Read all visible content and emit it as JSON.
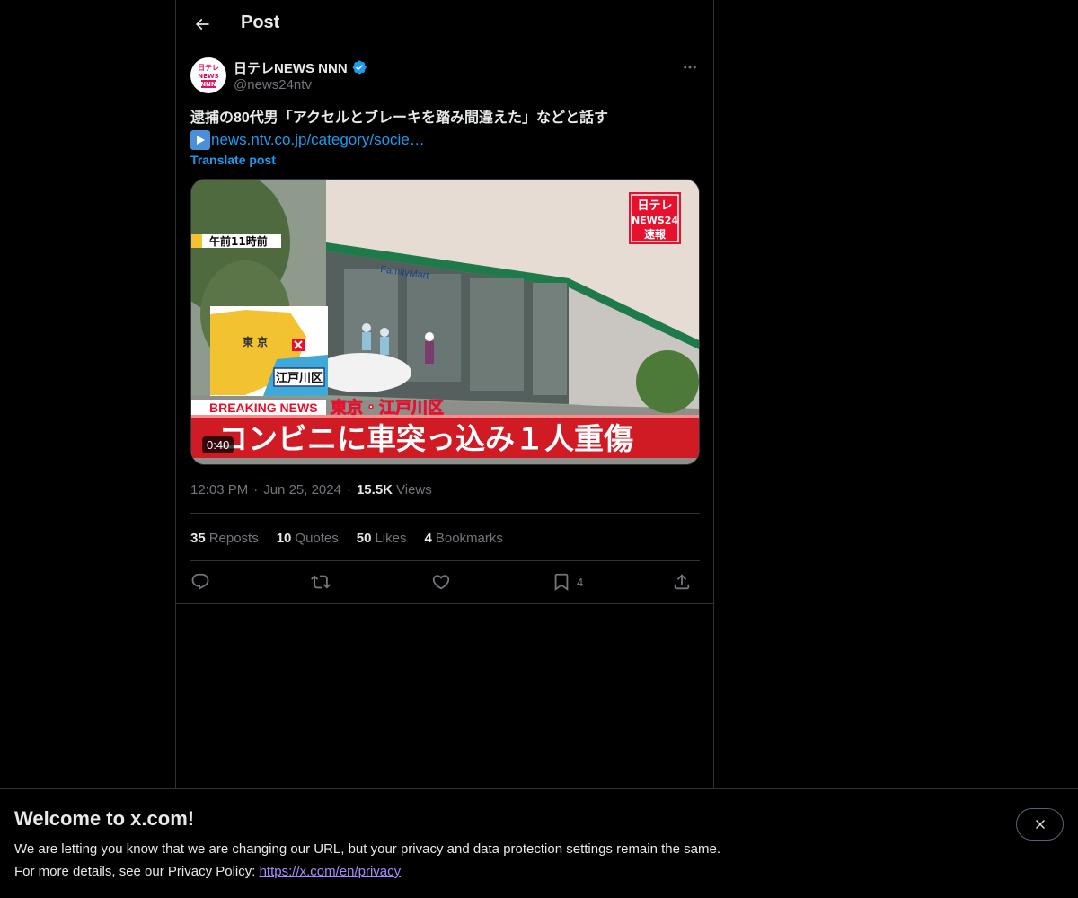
{
  "header": {
    "title": "Post"
  },
  "author": {
    "name": "日テレNEWS NNN",
    "handle": "@news24ntv",
    "verified": true,
    "avatar_text": "日テレ NEWS NNN"
  },
  "post": {
    "text": "逮捕の80代男「アクセルとブレーキを踏み間違えた」などと話す",
    "link_text": "news.ntv.co.jp/category/socie…",
    "translate_label": "Translate post"
  },
  "media": {
    "video_duration": "0:40",
    "overlay": {
      "time_caption": "午前11時前",
      "logo_line1": "日テレ",
      "logo_line2": "NEWS24",
      "logo_line3": "速報",
      "map_region": "東 京",
      "map_ward": "江戸川区",
      "breaking_label": "BREAKING NEWS",
      "location_caption": "東京・江戸川区",
      "headline": "コンビニに車突っ込み１人重傷",
      "store_sign": "FamilyMart"
    }
  },
  "meta": {
    "time": "12:03 PM",
    "date": "Jun 25, 2024",
    "views_count": "15.5K",
    "views_label": "Views"
  },
  "stats": {
    "reposts_count": "35",
    "reposts_label": "Reposts",
    "quotes_count": "10",
    "quotes_label": "Quotes",
    "likes_count": "50",
    "likes_label": "Likes",
    "bookmarks_count": "4",
    "bookmarks_label": "Bookmarks"
  },
  "actions": {
    "bookmark_count": "4",
    "icons": [
      "reply-icon",
      "repost-icon",
      "like-icon",
      "bookmark-icon",
      "share-icon"
    ]
  },
  "banner": {
    "title": "Welcome to x.com!",
    "line1": "We are letting you know that we are changing our URL, but your privacy and data protection settings remain the same.",
    "line2_prefix": "For more details, see our Privacy Policy: ",
    "privacy_link": "https://x.com/en/privacy"
  },
  "colors": {
    "background": "#000000",
    "text_primary": "#e7e9ea",
    "text_secondary": "#71767b",
    "accent": "#1d9bf0",
    "border": "#2f3336",
    "link_visited": "#a78bfa"
  }
}
